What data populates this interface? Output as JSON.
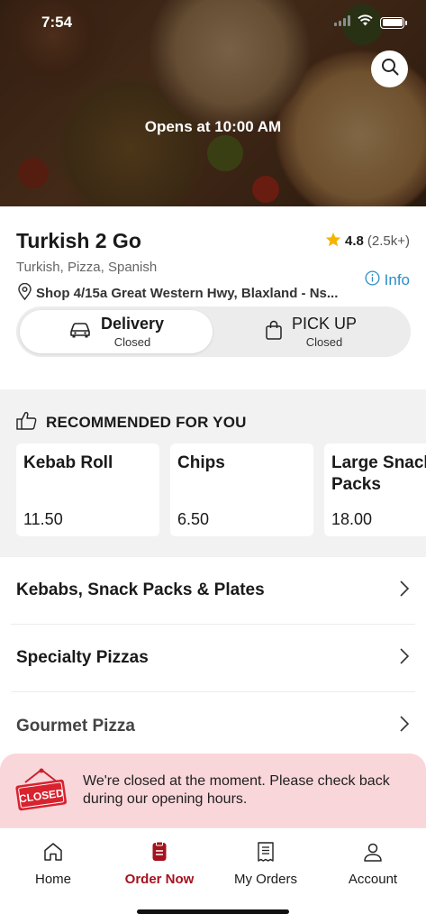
{
  "status_bar": {
    "time": "7:54"
  },
  "hero": {
    "opens_text": "Opens at 10:00 AM",
    "search_icon": "search-icon"
  },
  "restaurant": {
    "name": "Turkish 2 Go",
    "rating": "4.8",
    "rating_count": "(2.5k+)",
    "cuisine": "Turkish, Pizza, Spanish",
    "address": "Shop 4/15a Great Western Hwy, Blaxland - Ns...",
    "info_label": "Info"
  },
  "order_mode": {
    "delivery": {
      "label": "Delivery",
      "status": "Closed"
    },
    "pickup": {
      "label": "PICK UP",
      "status": "Closed"
    }
  },
  "recommended": {
    "title": "RECOMMENDED FOR YOU",
    "items": [
      {
        "name": "Kebab Roll",
        "price": "11.50"
      },
      {
        "name": "Chips",
        "price": "6.50"
      },
      {
        "name": "Large Snack Packs",
        "price": "18.00"
      }
    ]
  },
  "categories": [
    "Kebabs, Snack Packs & Plates",
    "Specialty Pizzas",
    "Gourmet Pizza"
  ],
  "closed_banner": {
    "sign_text": "CLOSED",
    "message": "We're closed at the moment. Please check back during our opening hours."
  },
  "nav": {
    "items": [
      {
        "label": "Home",
        "icon": "home-icon"
      },
      {
        "label": "Order Now",
        "icon": "order-icon"
      },
      {
        "label": "My Orders",
        "icon": "receipt-icon"
      },
      {
        "label": "Account",
        "icon": "account-icon"
      }
    ],
    "active": "Order Now"
  },
  "colors": {
    "accent": "#a3131e",
    "link": "#2b8fc7",
    "star": "#f5b400",
    "banner_bg": "#f9d6da"
  }
}
